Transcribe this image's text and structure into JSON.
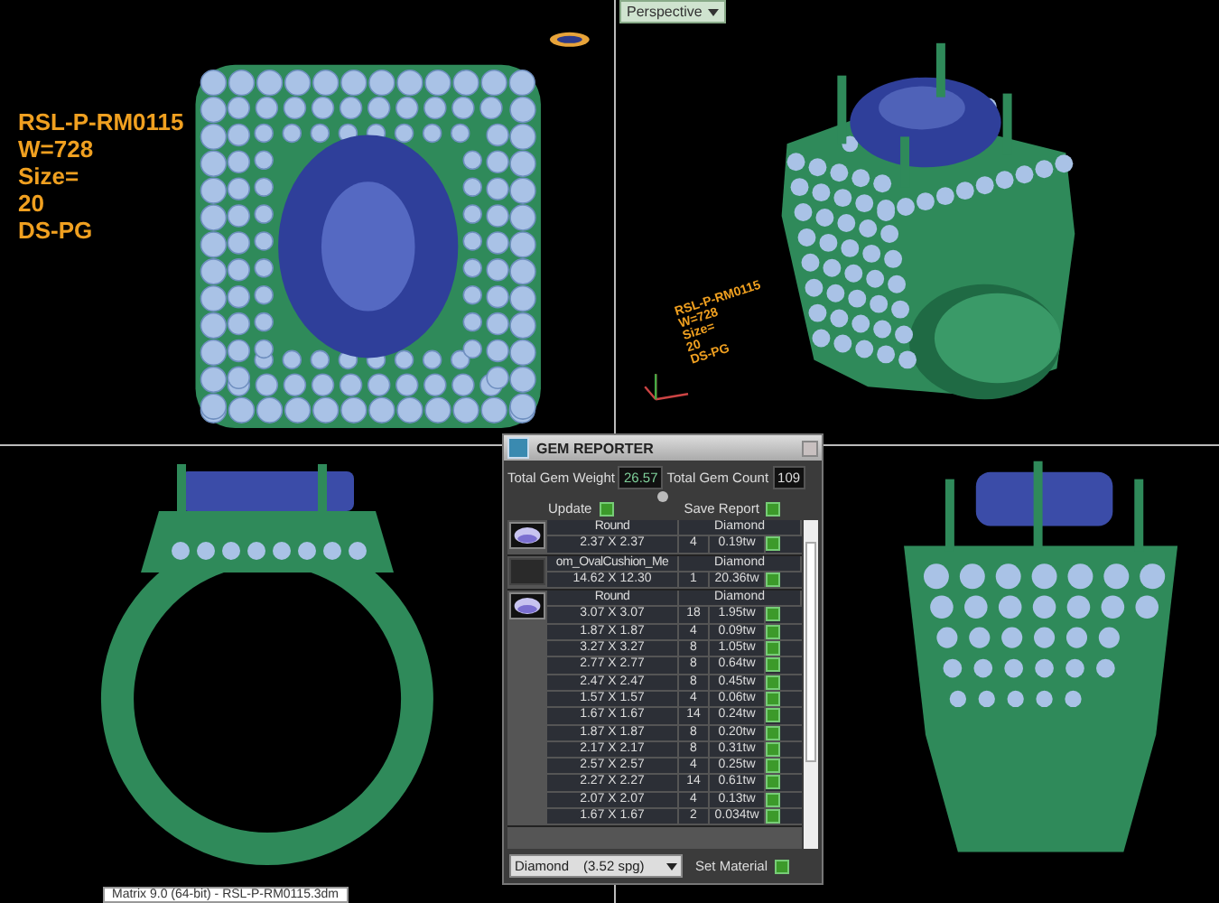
{
  "viewports": [
    {
      "kind": "top",
      "label": [
        "RSL-P-RM0115",
        "W=728",
        "Size=",
        "20",
        "DS-PG"
      ]
    },
    {
      "kind": "perspective",
      "tab": "Perspective",
      "label": [
        "RSL-P-RM0115",
        "W=728",
        "Size=",
        "20",
        "DS-PG"
      ]
    },
    {
      "kind": "front"
    },
    {
      "kind": "side"
    }
  ],
  "gem_reporter": {
    "title": "GEM REPORTER",
    "stats": [
      {
        "label": "Total Gem Weight",
        "value": "26.57"
      },
      {
        "label": "Total Gem Count",
        "value": "109"
      }
    ],
    "buttons": [
      "Update",
      "Save Report"
    ],
    "groups": [
      {
        "thumbnail": true,
        "shape": "Round",
        "material": "Diamond",
        "rows": [
          {
            "size": "2.37 X 2.37",
            "count": "4",
            "weight": "0.19tw"
          }
        ]
      },
      {
        "thumbnail": false,
        "shape": "om_OvalCushion_Me",
        "material": "Diamond",
        "rows": [
          {
            "size": "14.62 X 12.30",
            "count": "1",
            "weight": "20.36tw"
          }
        ]
      },
      {
        "thumbnail": true,
        "shape": "Round",
        "material": "Diamond",
        "rows": [
          {
            "size": "3.07 X 3.07",
            "count": "18",
            "weight": "1.95tw"
          },
          {
            "size": "1.87 X 1.87",
            "count": "4",
            "weight": "0.09tw"
          },
          {
            "size": "3.27 X 3.27",
            "count": "8",
            "weight": "1.05tw"
          },
          {
            "size": "2.77 X 2.77",
            "count": "8",
            "weight": "0.64tw"
          },
          {
            "size": "2.47 X 2.47",
            "count": "8",
            "weight": "0.45tw"
          },
          {
            "size": "1.57 X 1.57",
            "count": "4",
            "weight": "0.06tw"
          },
          {
            "size": "1.67 X 1.67",
            "count": "14",
            "weight": "0.24tw"
          },
          {
            "size": "1.87 X 1.87",
            "count": "8",
            "weight": "0.20tw"
          },
          {
            "size": "2.17 X 2.17",
            "count": "8",
            "weight": "0.31tw"
          },
          {
            "size": "2.57 X 2.57",
            "count": "4",
            "weight": "0.25tw"
          },
          {
            "size": "2.27 X 2.27",
            "count": "14",
            "weight": "0.61tw"
          },
          {
            "size": "2.07 X 2.07",
            "count": "4",
            "weight": "0.13tw"
          },
          {
            "size": "1.67 X 1.67",
            "count": "2",
            "weight": "0.034tw"
          }
        ]
      }
    ],
    "material_select": {
      "name": "Diamond",
      "density": "(3.52 spg)"
    },
    "set_material": "Set Material"
  },
  "tooltip": "Matrix 9.0 (64-bit) - RSL-P-RM0115.3dm"
}
